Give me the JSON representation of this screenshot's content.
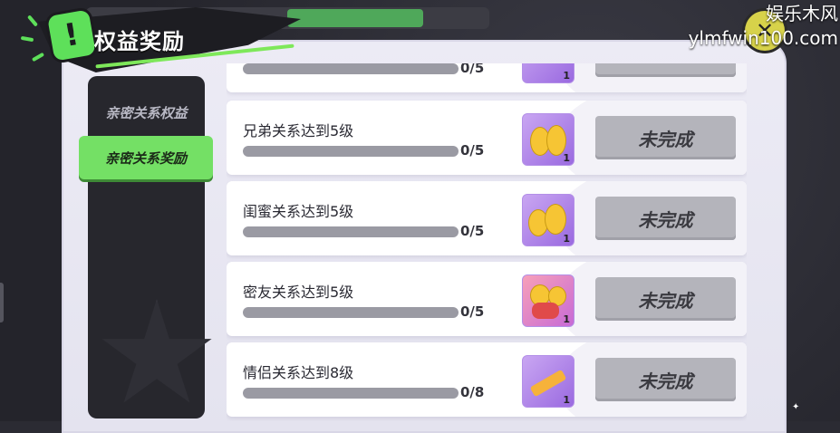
{
  "watermark": {
    "line1": "娱乐木风",
    "line2": "ylmfwin100.com"
  },
  "header": {
    "title": "权益奖励",
    "badge_symbol": "!"
  },
  "close_button": {
    "symbol": "✕"
  },
  "sidebar": {
    "items": [
      {
        "label": "亲密关系权益",
        "active": false
      },
      {
        "label": "亲密关系奖励",
        "active": true
      }
    ]
  },
  "tasks": [
    {
      "name": "",
      "progress_text": "0/5",
      "progress": 0,
      "reward_count": "1",
      "reward_icon": "purple-reward-icon",
      "status": ""
    },
    {
      "name": "兄弟关系达到5级",
      "progress_text": "0/5",
      "progress": 0,
      "reward_count": "1",
      "reward_icon": "brothers-dance-icon",
      "status": "未完成"
    },
    {
      "name": "闺蜜关系达到5级",
      "progress_text": "0/5",
      "progress": 0,
      "reward_count": "1",
      "reward_icon": "besties-dance-icon",
      "status": "未完成"
    },
    {
      "name": "密友关系达到5级",
      "progress_text": "0/5",
      "progress": 0,
      "reward_count": "1",
      "reward_icon": "friends-guitar-icon",
      "status": "未完成"
    },
    {
      "name": "情侣关系达到8级",
      "progress_text": "0/8",
      "progress": 0,
      "reward_count": "1",
      "reward_icon": "couple-item-icon",
      "status": "未完成"
    }
  ],
  "colors": {
    "accent_green": "#74e065",
    "reward_purple": "#9a6ae0",
    "status_gray": "#b4b4bb",
    "panel_bg": "#ecebf5"
  }
}
